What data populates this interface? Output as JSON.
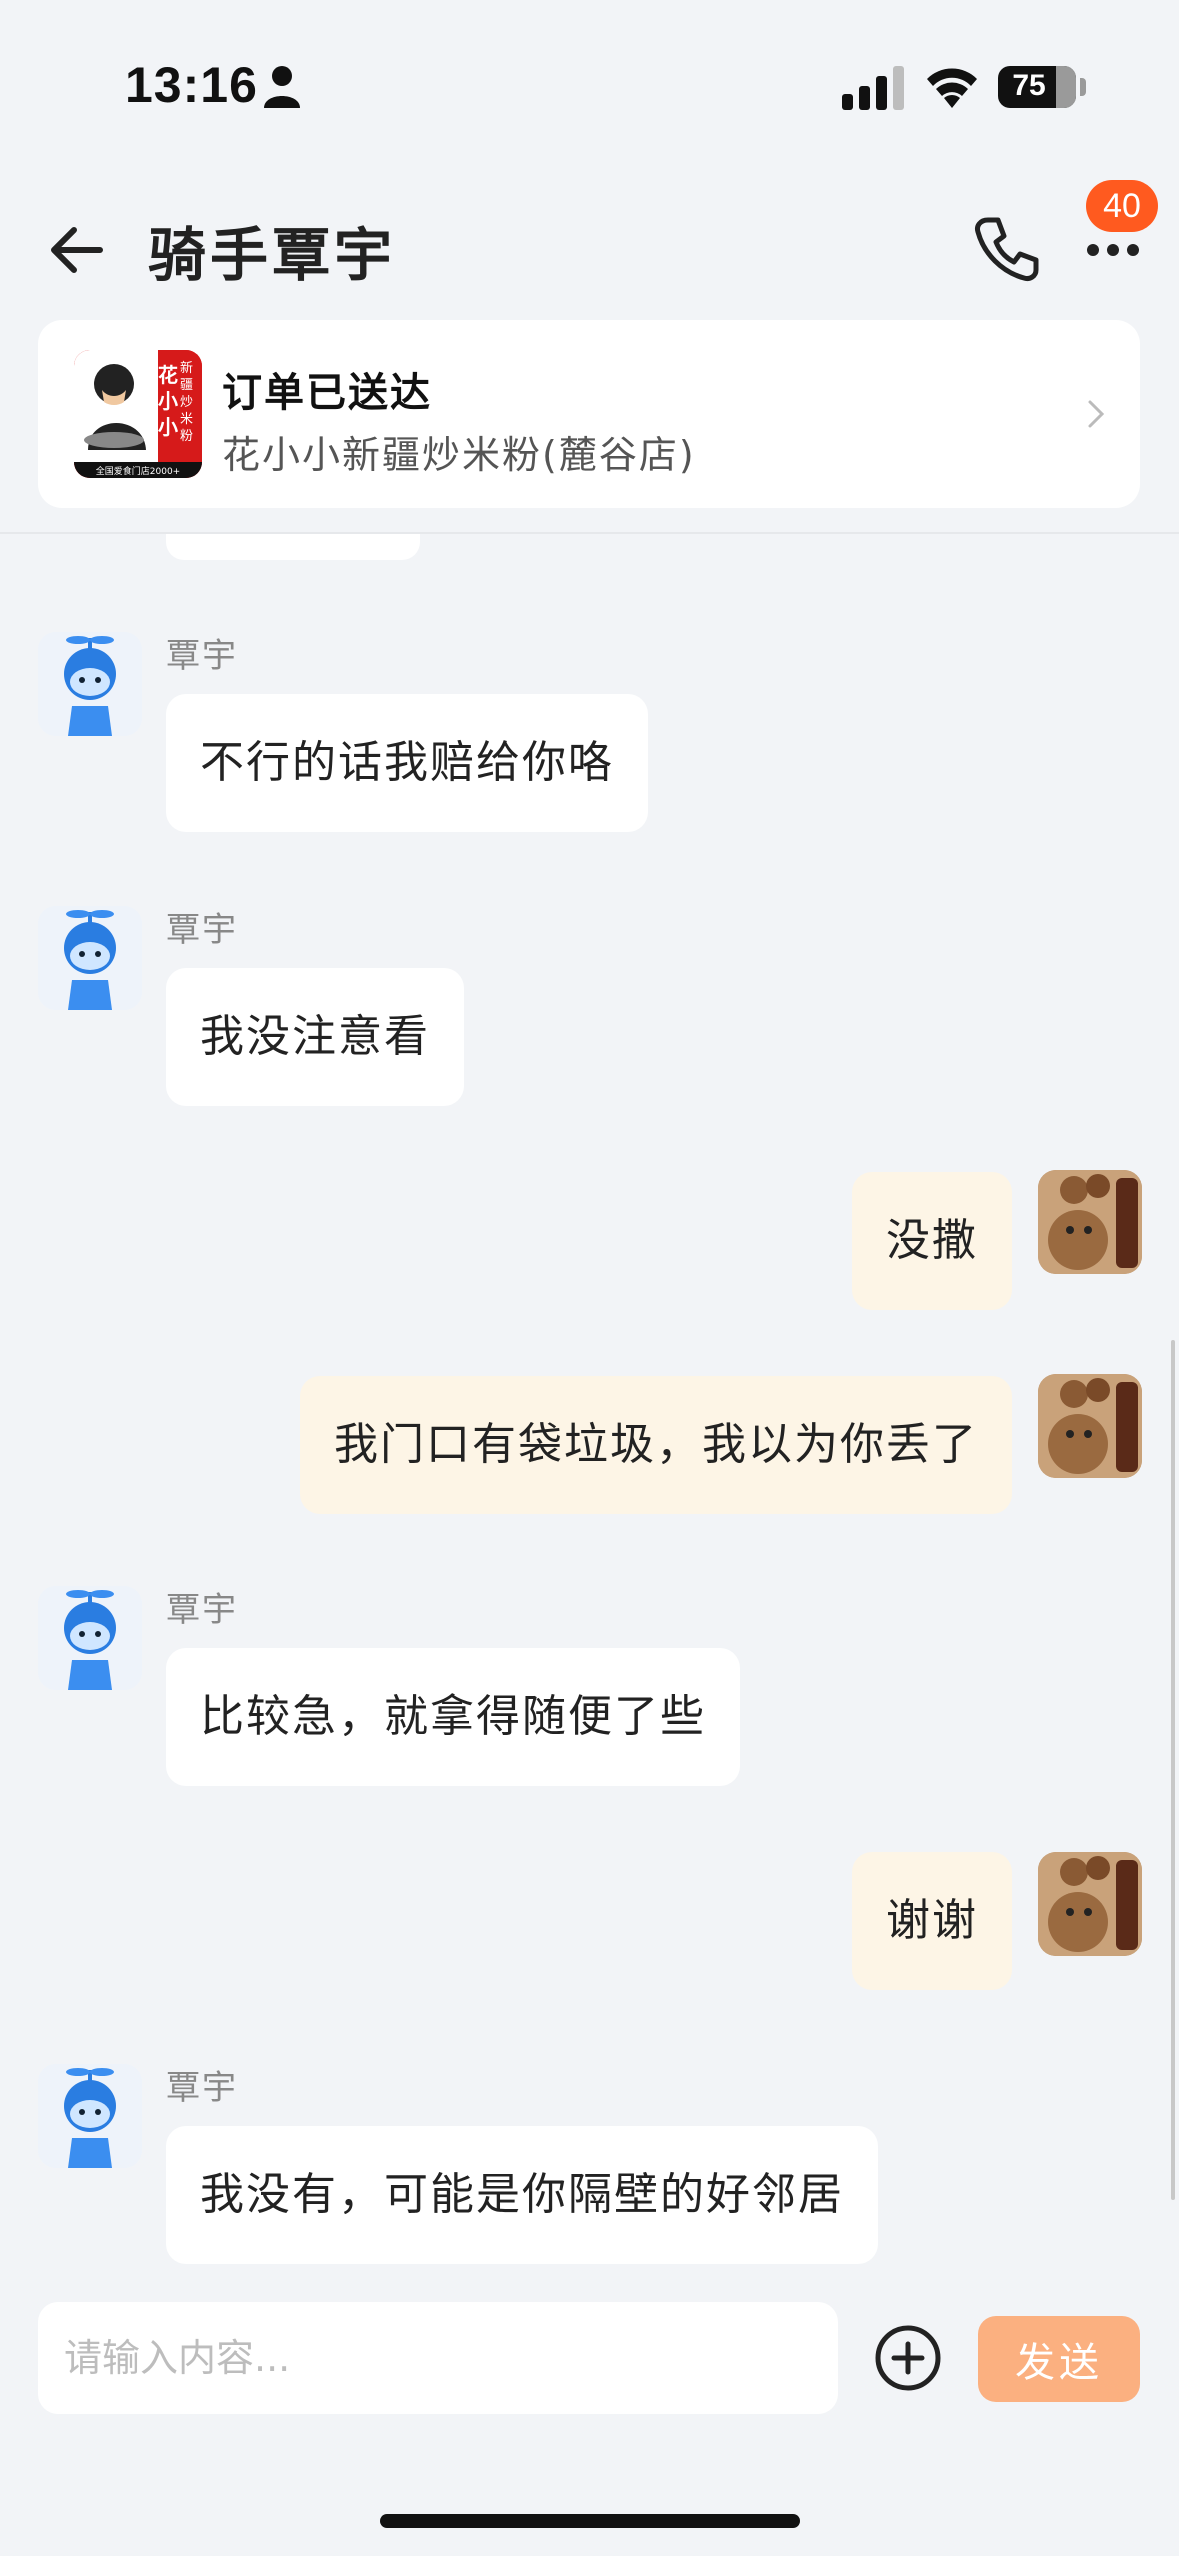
{
  "status_bar": {
    "time": "13:16",
    "battery": "75",
    "icons": [
      "person-icon",
      "cellular-signal-icon",
      "wifi-icon",
      "battery-icon"
    ]
  },
  "header": {
    "title": "骑手覃宇",
    "back_icon": "arrow-left-icon",
    "phone_icon": "phone-icon",
    "more_icon": "more-dots-icon",
    "badge": "40",
    "badge_color": "#ff5a1f"
  },
  "order_card": {
    "status": "订单已送达",
    "shop_name": "花小小新疆炒米粉(麓谷店)",
    "logo": {
      "brand": "花小小",
      "tagline": "新疆炒米粉",
      "footer": "全国爱食门店2000+"
    },
    "chevron_icon": "chevron-right-icon"
  },
  "messages": [
    {
      "sender": "覃宇",
      "side": "incoming",
      "text": "不行的话我赔给你咯"
    },
    {
      "sender": "覃宇",
      "side": "incoming",
      "text": "我没注意看"
    },
    {
      "sender": "",
      "side": "outgoing",
      "text": "没撒"
    },
    {
      "sender": "",
      "side": "outgoing",
      "text": "我门口有袋垃圾，我以为你丢了"
    },
    {
      "sender": "覃宇",
      "side": "incoming",
      "text": "比较急，就拿得随便了些"
    },
    {
      "sender": "",
      "side": "outgoing",
      "text": "谢谢"
    },
    {
      "sender": "覃宇",
      "side": "incoming",
      "text": "我没有，可能是你隔壁的好邻居"
    }
  ],
  "input_bar": {
    "placeholder": "请输入内容...",
    "value": "",
    "add_icon": "plus-circle-icon",
    "send_label": "发送",
    "send_color": "#fbb080"
  },
  "colors": {
    "background": "#f2f4f7",
    "incoming_bubble": "#ffffff",
    "outgoing_bubble": "#fdf5e6"
  }
}
